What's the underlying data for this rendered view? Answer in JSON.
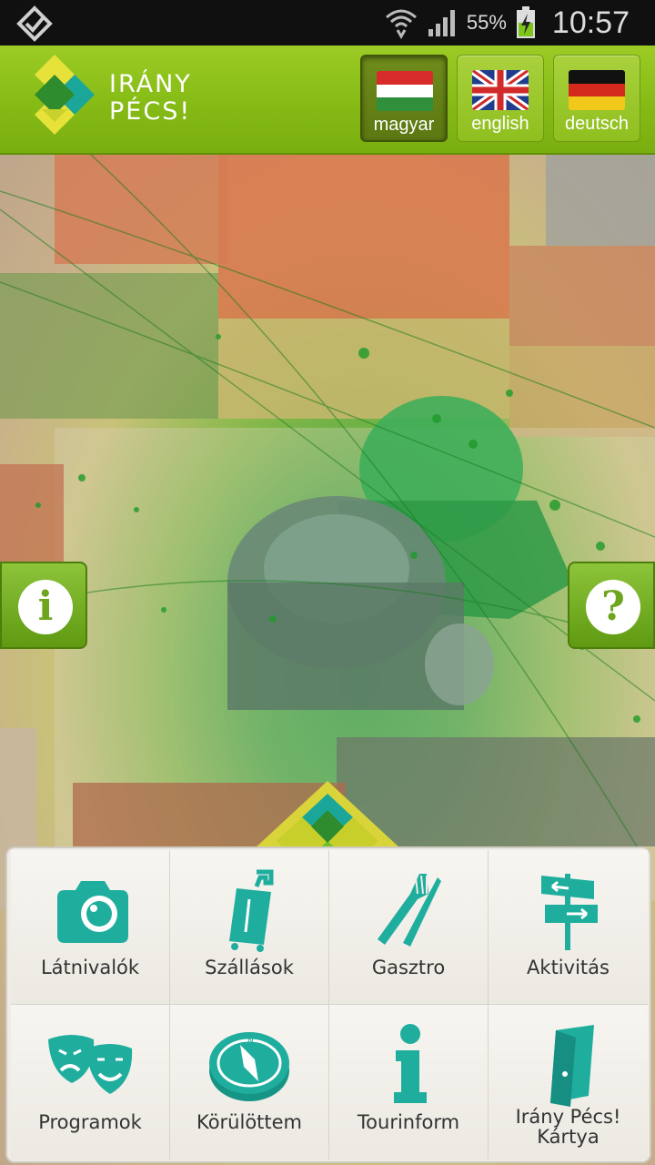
{
  "status_bar": {
    "battery_percent": "55%",
    "time": "10:57",
    "icons": [
      "notification-check-icon",
      "wifi-icon",
      "signal-icon",
      "battery-charging-icon"
    ]
  },
  "header": {
    "logo_line1": "IRÁNY",
    "logo_line2": "PÉCS!",
    "languages": [
      {
        "label": "magyar",
        "flag": "hungary-flag-icon",
        "active": true
      },
      {
        "label": "english",
        "flag": "uk-flag-icon",
        "active": false
      },
      {
        "label": "deutsch",
        "flag": "germany-flag-icon",
        "active": false
      }
    ]
  },
  "side_buttons": {
    "info": "i",
    "help": "?"
  },
  "menu": {
    "items": [
      {
        "label": "Látnivalók",
        "icon": "camera-icon"
      },
      {
        "label": "Szállások",
        "icon": "luggage-icon"
      },
      {
        "label": "Gasztro",
        "icon": "fork-knife-icon"
      },
      {
        "label": "Aktivitás",
        "icon": "signpost-icon"
      },
      {
        "label": "Programok",
        "icon": "theater-masks-icon"
      },
      {
        "label": "Körülöttem",
        "icon": "compass-icon"
      },
      {
        "label": "Tourinform",
        "icon": "info-icon"
      },
      {
        "label": "Irány Pécs! Kártya",
        "icon": "card-icon"
      }
    ]
  },
  "colors": {
    "brand_green": "#86bb16",
    "teal": "#1fb3a2",
    "menu_bg": "#efece6"
  }
}
